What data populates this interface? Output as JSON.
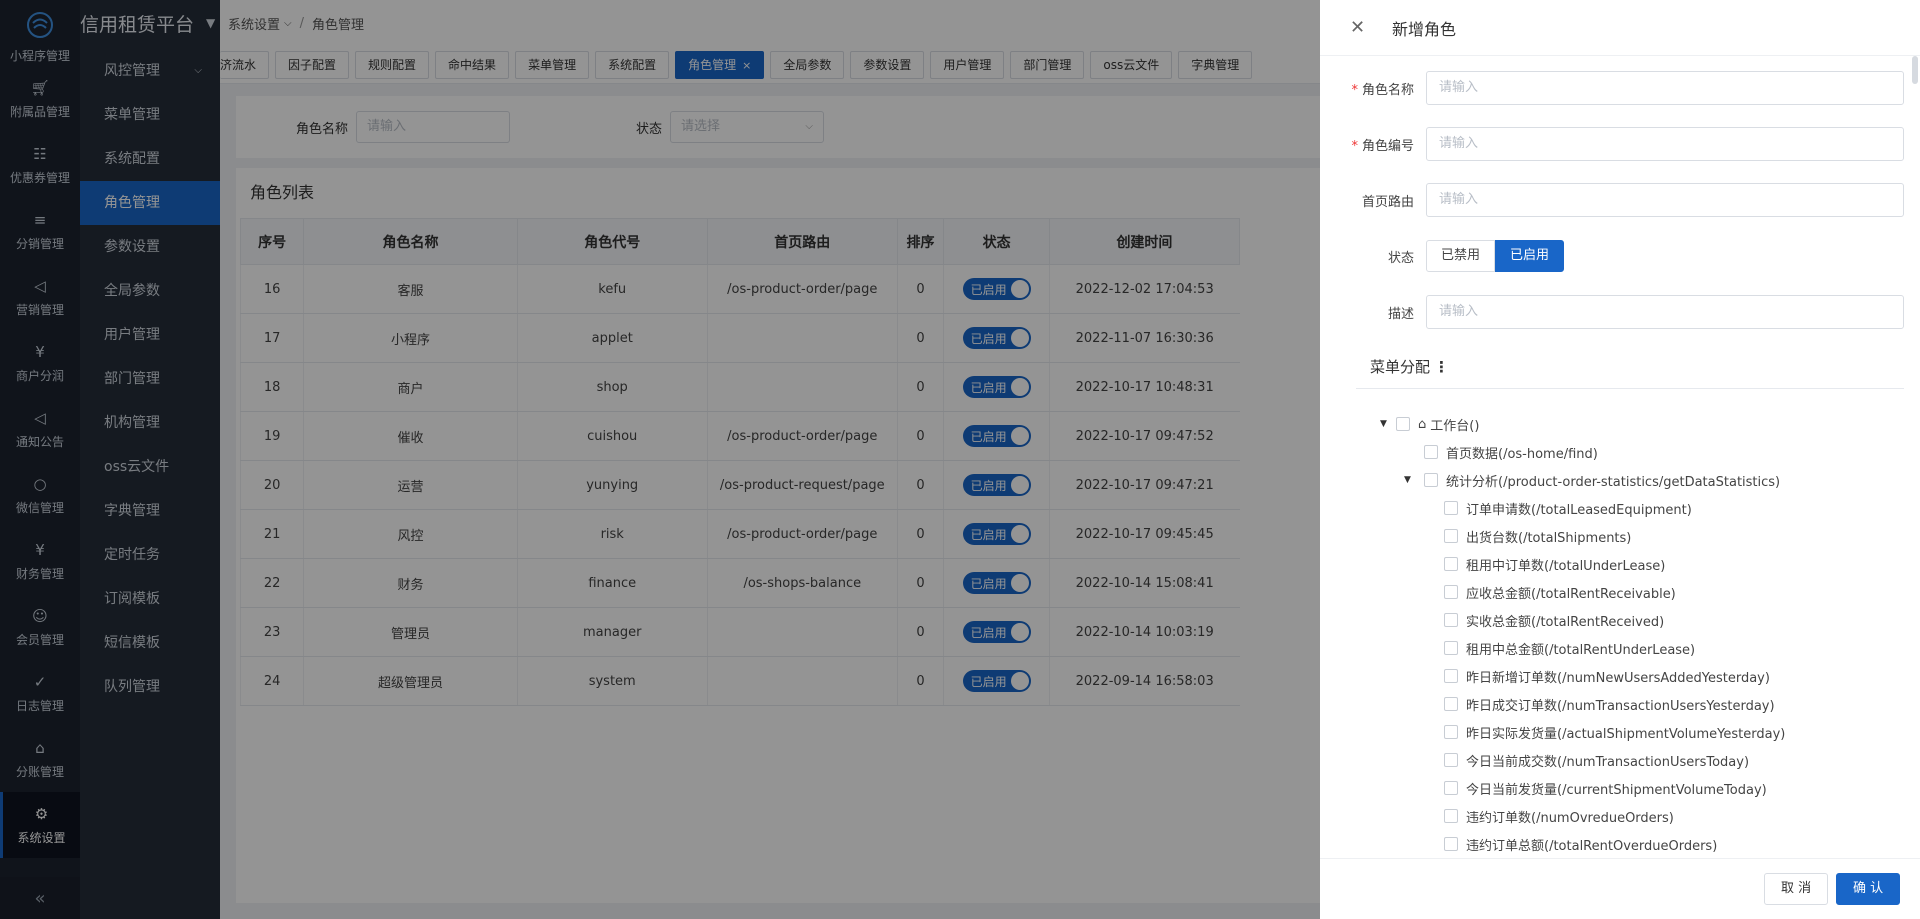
{
  "brand": "信用租赁平台",
  "rail": {
    "items": [
      {
        "label": "小程序管理",
        "icon": "miniapp-icon"
      },
      {
        "label": "附属品管理",
        "icon": "cart-icon"
      },
      {
        "label": "优惠券管理",
        "icon": "gift-icon"
      },
      {
        "label": "分销管理",
        "icon": "distribution-icon"
      },
      {
        "label": "营销管理",
        "icon": "megaphone-icon"
      },
      {
        "label": "商户分润",
        "icon": "yen-icon"
      },
      {
        "label": "通知公告",
        "icon": "notice-icon"
      },
      {
        "label": "微信管理",
        "icon": "wechat-icon"
      },
      {
        "label": "财务管理",
        "icon": "finance-icon"
      },
      {
        "label": "会员管理",
        "icon": "member-icon"
      },
      {
        "label": "日志管理",
        "icon": "shield-check-icon"
      },
      {
        "label": "分账管理",
        "icon": "split-icon"
      },
      {
        "label": "系统设置",
        "icon": "gear-icon"
      }
    ]
  },
  "submenu": {
    "items": [
      {
        "label": "风控管理"
      },
      {
        "label": "菜单管理"
      },
      {
        "label": "系统配置"
      },
      {
        "label": "角色管理"
      },
      {
        "label": "参数设置"
      },
      {
        "label": "全局参数"
      },
      {
        "label": "用户管理"
      },
      {
        "label": "部门管理"
      },
      {
        "label": "机构管理"
      },
      {
        "label": "oss云文件"
      },
      {
        "label": "字典管理"
      },
      {
        "label": "定时任务"
      },
      {
        "label": "订阅模板"
      },
      {
        "label": "短信模板"
      },
      {
        "label": "队列管理"
      }
    ]
  },
  "breadcrumb": {
    "parent": "系统设置",
    "sep": "/",
    "current": "角色管理"
  },
  "tabs": [
    "济流水",
    "因子配置",
    "规则配置",
    "命中结果",
    "菜单管理",
    "系统配置",
    "角色管理",
    "全局参数",
    "参数设置",
    "用户管理",
    "部门管理",
    "oss云文件",
    "字典管理"
  ],
  "filter": {
    "name_label": "角色名称",
    "name_placeholder": "请输入",
    "status_label": "状态",
    "status_placeholder": "请选择"
  },
  "table": {
    "title": "角色列表",
    "headers": [
      "序号",
      "角色名称",
      "角色代号",
      "首页路由",
      "排序",
      "状态",
      "创建时间"
    ],
    "rows": [
      [
        "16",
        "客服",
        "kefu",
        "/os-product-order/page",
        "0",
        "已启用",
        "2022-12-02 17:04:53"
      ],
      [
        "17",
        "小程序",
        "applet",
        "",
        "0",
        "已启用",
        "2022-11-07 16:30:36"
      ],
      [
        "18",
        "商户",
        "shop",
        "",
        "0",
        "已启用",
        "2022-10-17 10:48:31"
      ],
      [
        "19",
        "催收",
        "cuishou",
        "/os-product-order/page",
        "0",
        "已启用",
        "2022-10-17 09:47:52"
      ],
      [
        "20",
        "运营",
        "yunying",
        "/os-product-request/page",
        "0",
        "已启用",
        "2022-10-17 09:47:21"
      ],
      [
        "21",
        "风控",
        "risk",
        "/os-product-order/page",
        "0",
        "已启用",
        "2022-10-17 09:45:45"
      ],
      [
        "22",
        "财务",
        "finance",
        "/os-shops-balance",
        "0",
        "已启用",
        "2022-10-14 15:08:41"
      ],
      [
        "23",
        "管理员",
        "manager",
        "",
        "0",
        "已启用",
        "2022-10-14 10:03:19"
      ],
      [
        "24",
        "超级管理员",
        "system",
        "",
        "0",
        "已启用",
        "2022-09-14 16:58:03"
      ]
    ]
  },
  "drawer": {
    "title": "新增角色",
    "fields": {
      "role_name_label": "角色名称",
      "role_code_label": "角色编号",
      "home_route_label": "首页路由",
      "status_label": "状态",
      "desc_label": "描述",
      "placeholder": "请输入"
    },
    "status_options": {
      "disabled": "已禁用",
      "enabled": "已启用"
    },
    "menu_title": "菜单分配",
    "tree": {
      "root": "工作台()",
      "home": "首页数据(/os-home/find)",
      "stats": "统计分析(/product-order-statistics/getDataStatistics)",
      "stats_children": [
        "订单申请数(/totalLeasedEquipment)",
        "出货台数(/totalShipments)",
        "租用中订单数(/totalUnderLease)",
        "应收总金额(/totalRentReceivable)",
        "实收总金额(/totalRentReceived)",
        "租用中总金额(/totalRentUnderLease)",
        "昨日新增订单数(/numNewUsersAddedYesterday)",
        "昨日成交订单数(/numTransactionUsersYesterday)",
        "昨日实际发货量(/actualShipmentVolumeYesterday)",
        "今日当前成交数(/numTransactionUsersToday)",
        "今日当前发货量(/currentShipmentVolumeToday)",
        "违约订单数(/numOvredueOrders)",
        "违约订单总额(/totalRentOverdueOrders)"
      ]
    },
    "cancel_label": "取 消",
    "ok_label": "确 认"
  },
  "colors": {
    "primary": "#1966c8",
    "rail_bg": "#1d2430",
    "submenu_bg": "#252d3a"
  }
}
